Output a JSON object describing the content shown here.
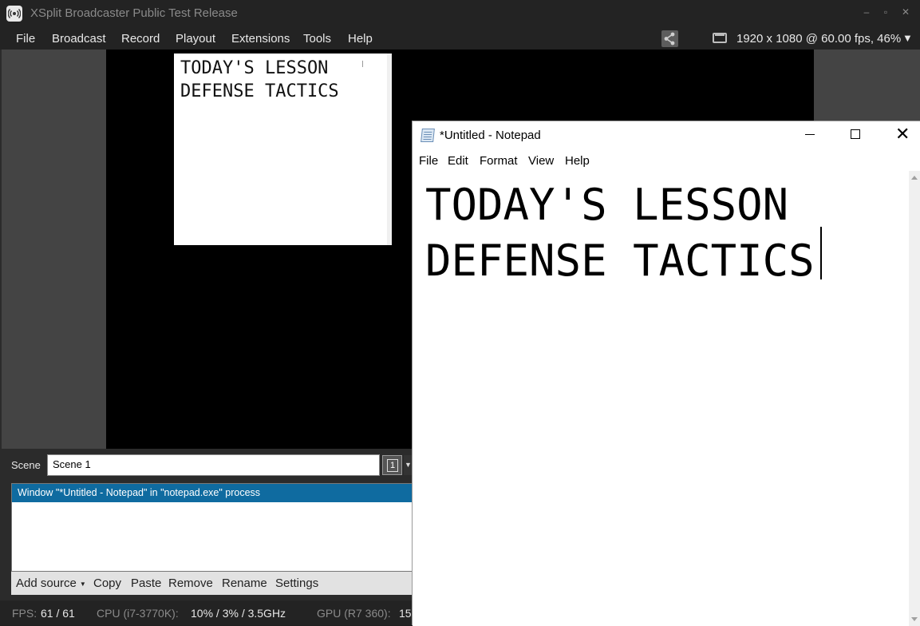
{
  "xsplit": {
    "title": "XSplit Broadcaster Public Test Release",
    "window_controls": {
      "minimize": "–",
      "maximize": "▫",
      "close": "✕"
    },
    "menu": [
      "File",
      "Broadcast",
      "Record",
      "Playout",
      "Extensions",
      "Tools",
      "Help"
    ],
    "resolution": "1920 x 1080 @ 60.00 fps, 46%",
    "preview_text": "TODAY'S LESSON\nDEFENSE TACTICS",
    "scene": {
      "label": "Scene",
      "name": "Scene 1",
      "number": "1"
    },
    "sources": [
      {
        "label": "Window \"*Untitled - Notepad\" in \"notepad.exe\" process",
        "selected": true
      }
    ],
    "source_toolbar": {
      "add_source": "Add source",
      "copy": "Copy",
      "paste": "Paste",
      "remove": "Remove",
      "rename": "Rename",
      "settings": "Settings"
    },
    "status": {
      "fps_label": "FPS:",
      "fps_value": "61 / 61",
      "cpu_label": "CPU (i7-3770K):",
      "cpu_value": "10% / 3% / 3.5GHz",
      "gpu_label": "GPU (R7 360):",
      "gpu_value": "15"
    }
  },
  "notepad": {
    "title": "*Untitled - Notepad",
    "menu": [
      "File",
      "Edit",
      "Format",
      "View",
      "Help"
    ],
    "text": "TODAY'S LESSON\nDEFENSE TACTICS",
    "close_glyph": "✕"
  },
  "colors": {
    "selection": "#0f6ba0",
    "dark_chrome": "#232323",
    "preview_gray": "#444444"
  }
}
